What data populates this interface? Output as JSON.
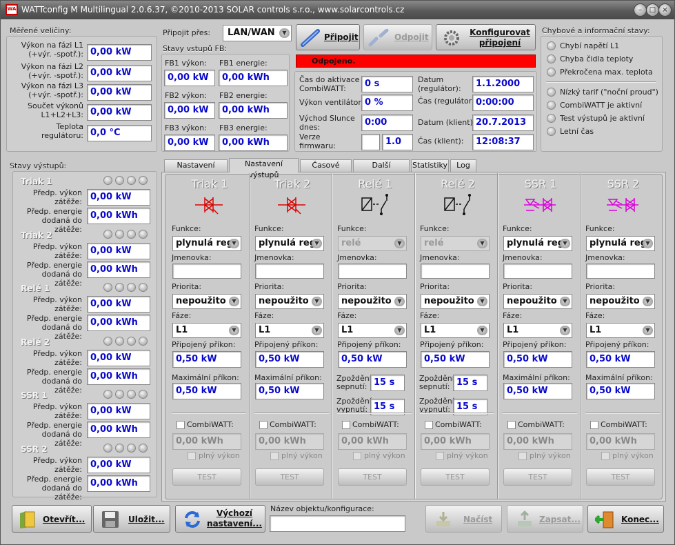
{
  "title": "WATTconfig M  Multilingual 2.0.6.37, ©2010-2013 SOLAR controls s.r.o., www.solarcontrols.cz",
  "app_icon": "WA",
  "meas": {
    "title": "Měřené veličiny:",
    "rows": [
      {
        "label": "Výkon na fázi L1\n(+výr. -spotř.):",
        "value": "0,00 kW"
      },
      {
        "label": "Výkon na fázi L2\n(+výr. -spotř.):",
        "value": "0,00 kW"
      },
      {
        "label": "Výkon na fázi L3\n(+výr. -spotř.):",
        "value": "0,00 kW"
      },
      {
        "label": "Součet výkonů\nL1+L2+L3:",
        "value": "0,00 kW"
      },
      {
        "label": "Teplota\nregulátoru:",
        "value": "0,0 °C"
      }
    ]
  },
  "conn": {
    "label": "Připojit přes:",
    "value": "LAN/WAN",
    "connect": "Připojit",
    "disconnect": "Odpojit",
    "configure": "Konfigurovat\npřipojení",
    "status": "Odpojeno."
  },
  "fb": {
    "title": "Stavy vstupů FB:",
    "rows": [
      {
        "p_label": "FB1 výkon:",
        "p": "0,00 kW",
        "e_label": "FB1 energie:",
        "e": "0,00 kWh"
      },
      {
        "p_label": "FB2 výkon:",
        "p": "0,00 kW",
        "e_label": "FB2 energie:",
        "e": "0,00 kWh"
      },
      {
        "p_label": "FB3 výkon:",
        "p": "0,00 kW",
        "e_label": "FB3 energie:",
        "e": "0,00 kWh"
      }
    ]
  },
  "info": {
    "combi_label": "Čas do aktivace\nCombiWATT:",
    "combi": "0 s",
    "vent_label": "Výkon ventilátoru:",
    "vent": "0 %",
    "sun_label": "Východ Slunce\ndnes:",
    "sun": "0:00",
    "fw_label": "Verze\nfirmwaru:",
    "fw_a": "",
    "fw_b": "1.0",
    "date_reg_label": "Datum\n(regulátor):",
    "date_reg": "1.1.2000",
    "time_reg_label": "Čas (regulátor):",
    "time_reg": "0:00:00",
    "date_cli_label": "Datum (klient):",
    "date_cli": "20.7.2013",
    "time_cli_label": "Čas (klient):",
    "time_cli": "12:08:37"
  },
  "errors": {
    "title": "Chybové a informační stavy:",
    "items": [
      "Chybí napětí L1",
      "Chyba čidla teploty",
      "Překročena max. teplota"
    ],
    "items2": [
      "Nízký tarif (\"noční proud\")",
      "CombiWATT je aktivní",
      "Test výstupů je aktivní",
      "Letní čas"
    ]
  },
  "outputs_side": {
    "title": "Stavy výstupů:",
    "p_label": "Předp. výkon\nzátěže:",
    "e_label": "Předp. energie\ndodaná do zátěže:",
    "items": [
      {
        "name": "Triak 1",
        "p": "0,00 kW",
        "e": "0,00 kWh"
      },
      {
        "name": "Triak 2",
        "p": "0,00 kW",
        "e": "0,00 kWh"
      },
      {
        "name": "Relé 1",
        "p": "0,00 kW",
        "e": "0,00 kWh"
      },
      {
        "name": "Relé 2",
        "p": "0,00 kW",
        "e": "0,00 kWh"
      },
      {
        "name": "SSR 1",
        "p": "0,00 kW",
        "e": "0,00 kWh"
      },
      {
        "name": "SSR 2",
        "p": "0,00 kW",
        "e": "0,00 kWh"
      }
    ]
  },
  "tabs": [
    "Nastavení vstupů",
    "Nastavení výstupů",
    "Časové plány",
    "Další nastavení",
    "Statistiky",
    "Log"
  ],
  "labels": {
    "funkce": "Funkce:",
    "jmenovka": "Jmenovka:",
    "priorita": "Priorita:",
    "faze": "Fáze:",
    "prikon": "Připojený příkon:",
    "max": "Maximální příkon:",
    "zap": "Zpoždění\nsepnutí:",
    "vyp": "Zpoždění\nvypnutí:",
    "combi": "CombiWATT:",
    "plny": "plný výkon",
    "test": "TEST"
  },
  "columns": [
    {
      "name": "Triak 1",
      "icon": "triac",
      "func": "plynulá reg.",
      "prio": "nepoužito",
      "faze": "L1",
      "prikon": "0,50 kW",
      "max": "0,50 kW",
      "combi": "0,00 kWh"
    },
    {
      "name": "Triak 2",
      "icon": "triac",
      "func": "plynulá reg.",
      "prio": "nepoužito",
      "faze": "L1",
      "prikon": "0,50 kW",
      "max": "0,50 kW",
      "combi": "0,00 kWh"
    },
    {
      "name": "Relé 1",
      "icon": "relay",
      "func": "relé",
      "prio": "nepoužito",
      "faze": "L1",
      "prikon": "0,50 kW",
      "zap": "15 s",
      "vyp": "15 s",
      "combi": "0,00 kWh"
    },
    {
      "name": "Relé 2",
      "icon": "relay",
      "func": "relé",
      "prio": "nepoužito",
      "faze": "L1",
      "prikon": "0,50 kW",
      "zap": "15 s",
      "vyp": "15 s",
      "combi": "0,00 kWh"
    },
    {
      "name": "SSR 1",
      "icon": "ssr",
      "func": "plynulá reg.",
      "prio": "nepoužito",
      "faze": "L1",
      "prikon": "0,50 kW",
      "max": "0,50 kW",
      "combi": "0,00 kWh"
    },
    {
      "name": "SSR 2",
      "icon": "ssr",
      "func": "plynulá reg.",
      "prio": "nepoužito",
      "faze": "L1",
      "prikon": "0,50 kW",
      "max": "0,50 kW",
      "combi": "0,00 kWh"
    }
  ],
  "bottom": {
    "open": "Otevřít...",
    "save": "Uložit...",
    "defaults": "Výchozí\nnastavení...",
    "objname_label": "Název objektu/konfigurace:",
    "objname": "",
    "read": "Načíst",
    "write": "Zapsat...",
    "end": "Konec..."
  },
  "colors": {
    "status_red": "#ff0000",
    "value_blue": "#0a0acc",
    "triac": "#dd0000",
    "ssr": "#dd00dd"
  }
}
